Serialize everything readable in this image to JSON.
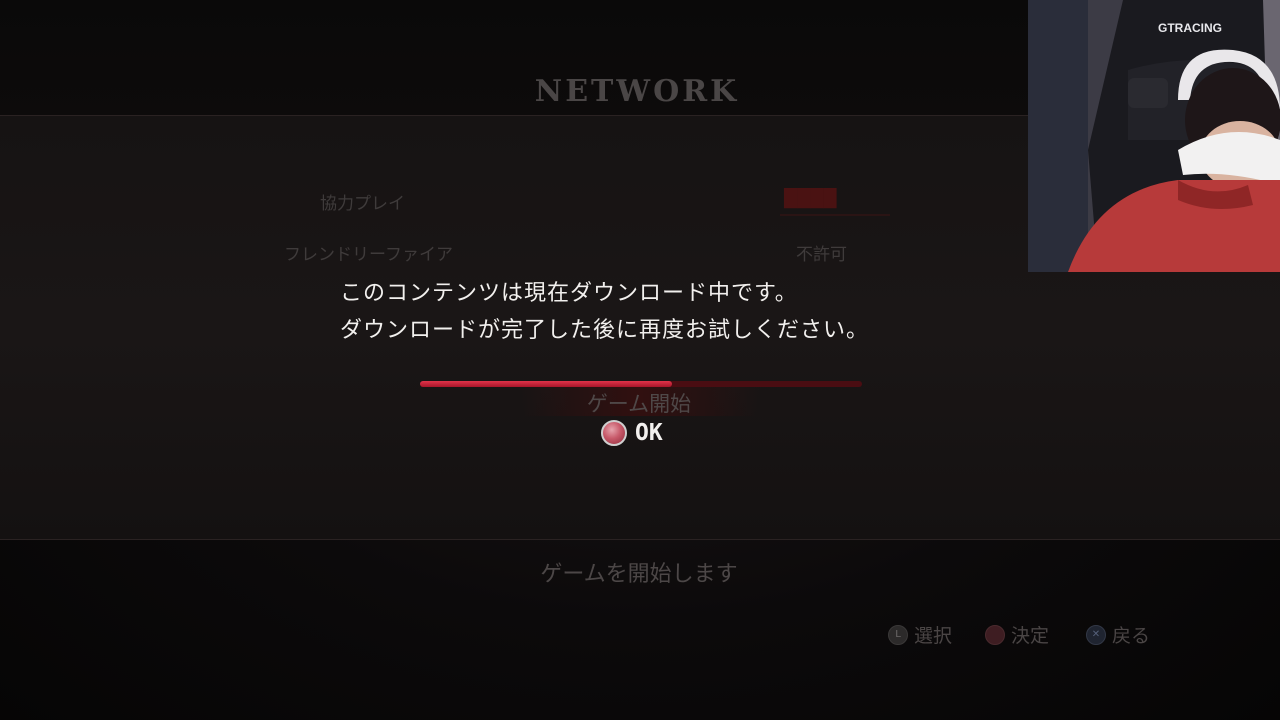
{
  "screen": {
    "title": "NETWORK"
  },
  "menu": {
    "items": [
      {
        "label": "協力プレイ",
        "value": "████"
      },
      {
        "label": "フレンドリーファイア",
        "value": "不許可"
      }
    ],
    "start_label": "ゲーム開始",
    "description": "ゲームを開始します"
  },
  "dialog": {
    "line1": "このコンテンツは現在ダウンロード中です。",
    "line2": "ダウンロードが完了した後に再度お試しください。",
    "progress": 0.57,
    "ok_label": "OK"
  },
  "hints": [
    {
      "icon": "l-button-icon",
      "glyph": "L",
      "label": "選択"
    },
    {
      "icon": "circle-button-icon",
      "glyph": "",
      "label": "決定"
    },
    {
      "icon": "cross-button-icon",
      "glyph": "✕",
      "label": "戻る"
    }
  ],
  "webcam": {
    "chair_brand": "GTRACING"
  },
  "colors": {
    "accent": "#c8203a",
    "progress_track": "#4a0d12",
    "dialog_text": "#f2f0ee"
  }
}
